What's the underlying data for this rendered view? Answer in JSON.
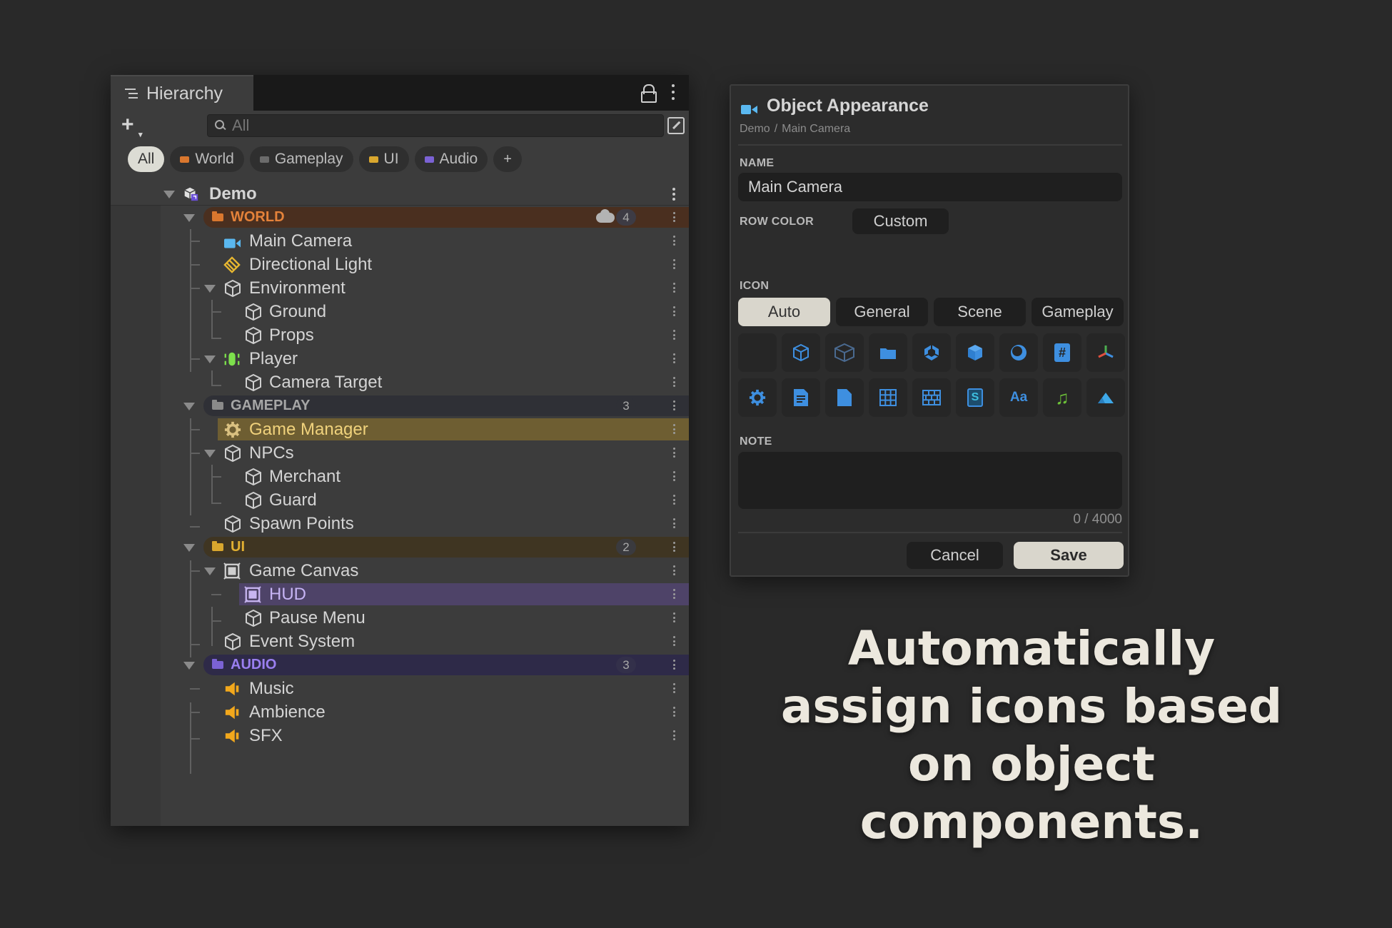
{
  "hierarchy": {
    "tab_title": "Hierarchy",
    "search_placeholder": "All",
    "filters": [
      {
        "label": "All",
        "active": true
      },
      {
        "label": "World",
        "color": "#d9772e"
      },
      {
        "label": "Gameplay",
        "color": "#6b6b6b"
      },
      {
        "label": "UI",
        "color": "#d9a72e"
      },
      {
        "label": "Audio",
        "color": "#7b62d4"
      }
    ],
    "add_filter_label": "+",
    "scene_name": "Demo",
    "groups": {
      "world": {
        "label": "WORLD",
        "count": "4",
        "color": "#d9772e"
      },
      "gameplay": {
        "label": "GAMEPLAY",
        "count": "3",
        "color": "#8a8a8a"
      },
      "ui": {
        "label": "UI",
        "count": "2",
        "color": "#d9a72e"
      },
      "audio": {
        "label": "AUDIO",
        "count": "3",
        "color": "#7b62d4"
      }
    },
    "items": {
      "main_camera": "Main Camera",
      "directional_light": "Directional Light",
      "environment": "Environment",
      "ground": "Ground",
      "props": "Props",
      "player": "Player",
      "camera_target": "Camera Target",
      "game_manager": "Game Manager",
      "npcs": "NPCs",
      "merchant": "Merchant",
      "guard": "Guard",
      "spawn_points": "Spawn Points",
      "game_canvas": "Game Canvas",
      "hud": "HUD",
      "pause_menu": "Pause Menu",
      "event_system": "Event System",
      "music": "Music",
      "ambience": "Ambience",
      "sfx": "SFX"
    }
  },
  "appearance": {
    "title": "Object Appearance",
    "breadcrumb": [
      "Demo",
      "/",
      "Main Camera"
    ],
    "name_label": "NAME",
    "name_value": "Main Camera",
    "row_color_label": "ROW COLOR",
    "row_color_value": "Custom",
    "icon_label": "ICON",
    "icon_tabs": [
      "Auto",
      "General",
      "Scene",
      "Gameplay"
    ],
    "icon_grid": [
      {
        "icon": "none-icon",
        "text": ""
      },
      {
        "icon": "cube-outline-icon",
        "text": ""
      },
      {
        "icon": "cube-wire-icon",
        "text": ""
      },
      {
        "icon": "folder-icon",
        "text": ""
      },
      {
        "icon": "unity-logo-icon",
        "text": ""
      },
      {
        "icon": "cube-solid-icon",
        "text": ""
      },
      {
        "icon": "sphere-icon",
        "text": ""
      },
      {
        "icon": "script-icon",
        "text": "#"
      },
      {
        "icon": "transform-axes-icon",
        "text": ""
      },
      {
        "icon": "gear-icon",
        "text": ""
      },
      {
        "icon": "document-icon",
        "text": ""
      },
      {
        "icon": "file-icon",
        "text": ""
      },
      {
        "icon": "grid-icon",
        "text": ""
      },
      {
        "icon": "tilemap-icon",
        "text": ""
      },
      {
        "icon": "scriptable-object-icon",
        "text": "S"
      },
      {
        "icon": "font-icon",
        "text": "Aa"
      },
      {
        "icon": "music-note-icon",
        "text": "♫"
      },
      {
        "icon": "terrain-icon",
        "text": ""
      }
    ],
    "note_label": "NOTE",
    "note_value": "",
    "note_counter": "0 / 4000",
    "cancel_label": "Cancel",
    "save_label": "Save"
  },
  "caption": "Automatically assign icons based on object components."
}
